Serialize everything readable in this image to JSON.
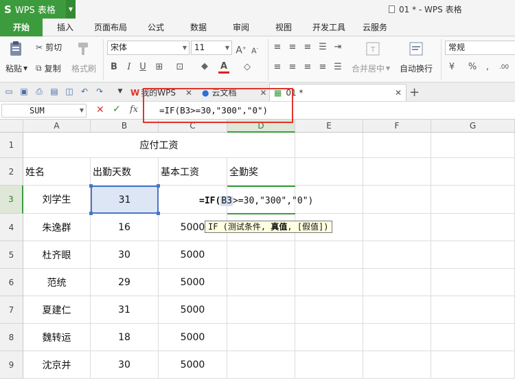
{
  "titlebar": {
    "app_name": "WPS 表格",
    "app_icon": "S",
    "document_title": "01 * - WPS 表格"
  },
  "ribbon_tabs": [
    "开始",
    "插入",
    "页面布局",
    "公式",
    "数据",
    "审阅",
    "视图",
    "开发工具",
    "云服务"
  ],
  "ribbon": {
    "paste": "粘贴",
    "cut": "剪切",
    "copy": "复制",
    "format_painter": "格式刷",
    "font_name": "宋体",
    "font_size": "11",
    "bold": "B",
    "italic": "I",
    "underline": "U",
    "merge_center": "合并居中",
    "wrap_text": "自动换行",
    "number_format": "常规",
    "percent": "%"
  },
  "doc_tabs": {
    "my_wps": "我的WPS",
    "cloud_docs": "云文档",
    "file": "01 *",
    "add": "+"
  },
  "formula_bar": {
    "name_box": "SUM",
    "fx": "fx",
    "formula": "=IF(B3>=30,\"300\",\"0\")"
  },
  "columns": [
    "A",
    "B",
    "C",
    "D",
    "E",
    "F",
    "G"
  ],
  "rows": [
    "1",
    "2",
    "3",
    "4",
    "5",
    "6",
    "7",
    "8",
    "9"
  ],
  "sheet": {
    "title": "应付工资",
    "headers": [
      "姓名",
      "出勤天数",
      "基本工资",
      "全勤奖"
    ],
    "data": [
      [
        "刘学生",
        "31",
        "",
        ""
      ],
      [
        "朱逸群",
        "16",
        "5000",
        ""
      ],
      [
        "杜齐眼",
        "30",
        "5000",
        ""
      ],
      [
        "范统",
        "29",
        "5000",
        ""
      ],
      [
        "夏建仁",
        "31",
        "5000",
        ""
      ],
      [
        "魏转运",
        "18",
        "5000",
        ""
      ],
      [
        "沈京并",
        "30",
        "5000",
        ""
      ]
    ]
  },
  "cell_edit": {
    "prefix": "=IF(",
    "ref": "B3",
    "suffix": ">=30,\"300\",\"0\")"
  },
  "tooltip": {
    "prefix": "IF (测试条件, ",
    "bold": "真值",
    "suffix": ", [假值])"
  },
  "accent_color": "#3c9b3c",
  "highlight_color": "#e0332b"
}
